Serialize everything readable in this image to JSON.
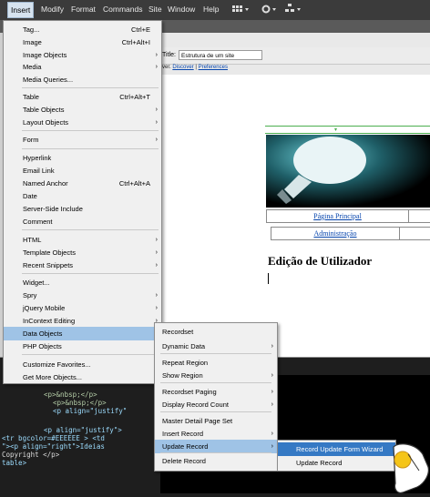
{
  "menubar": {
    "items": [
      "Insert",
      "Modify",
      "Format",
      "Commands",
      "Site",
      "Window",
      "Help"
    ]
  },
  "document": {
    "title_label": "Title:",
    "title_value": "Estrutura de um site",
    "infobar_prefix": "rver.",
    "infobar_link1": "Discover",
    "infobar_sep": "|",
    "infobar_link2": "Preferences",
    "nav_link1": "Página Principal",
    "nav_link2": "Administração",
    "heading": "Edição de Utilizador"
  },
  "code": {
    "lines": [
      "2>",
      "<p>&nbsp;</p>",
      "<p>&nbsp;</p>",
      "<p align=\"justify\"",
      "<p align=\"justify\">",
      "<tr bgcolor=#EEEEEE > <td",
      "\"><p align=\"right\">Ideias",
      "Copyright </p>",
      "table>"
    ]
  },
  "insert_menu": {
    "items": [
      {
        "label": "Tag...",
        "shortcut": "Ctrl+E",
        "sub": false
      },
      {
        "label": "Image",
        "shortcut": "Ctrl+Alt+I",
        "sub": false
      },
      {
        "label": "Image Objects",
        "shortcut": "",
        "sub": true
      },
      {
        "label": "Media",
        "shortcut": "",
        "sub": true
      },
      {
        "label": "Media Queries...",
        "shortcut": "",
        "sub": false
      },
      {
        "label": "Table",
        "shortcut": "Ctrl+Alt+T",
        "sub": false
      },
      {
        "label": "Table Objects",
        "shortcut": "",
        "sub": true
      },
      {
        "label": "Layout Objects",
        "shortcut": "",
        "sub": true
      },
      {
        "label": "Form",
        "shortcut": "",
        "sub": true
      },
      {
        "label": "Hyperlink",
        "shortcut": "",
        "sub": false
      },
      {
        "label": "Email Link",
        "shortcut": "",
        "sub": false
      },
      {
        "label": "Named Anchor",
        "shortcut": "Ctrl+Alt+A",
        "sub": false
      },
      {
        "label": "Date",
        "shortcut": "",
        "sub": false
      },
      {
        "label": "Server-Side Include",
        "shortcut": "",
        "sub": false
      },
      {
        "label": "Comment",
        "shortcut": "",
        "sub": false
      },
      {
        "label": "HTML",
        "shortcut": "",
        "sub": true
      },
      {
        "label": "Template Objects",
        "shortcut": "",
        "sub": true
      },
      {
        "label": "Recent Snippets",
        "shortcut": "",
        "sub": true
      },
      {
        "label": "Widget...",
        "shortcut": "",
        "sub": false
      },
      {
        "label": "Spry",
        "shortcut": "",
        "sub": true
      },
      {
        "label": "jQuery Mobile",
        "shortcut": "",
        "sub": true
      },
      {
        "label": "InContext Editing",
        "shortcut": "",
        "sub": true
      },
      {
        "label": "Data Objects",
        "shortcut": "",
        "sub": true
      },
      {
        "label": "PHP Objects",
        "shortcut": "",
        "sub": true
      },
      {
        "label": "Customize Favorites...",
        "shortcut": "",
        "sub": false
      },
      {
        "label": "Get More Objects...",
        "shortcut": "",
        "sub": false
      }
    ]
  },
  "data_objects_menu": {
    "items": [
      {
        "label": "Recordset",
        "sub": false
      },
      {
        "label": "Dynamic Data",
        "sub": true
      },
      {
        "label": "Repeat Region",
        "sub": false
      },
      {
        "label": "Show Region",
        "sub": true
      },
      {
        "label": "Recordset Paging",
        "sub": true
      },
      {
        "label": "Display Record Count",
        "sub": true
      },
      {
        "label": "Master Detail Page Set",
        "sub": false
      },
      {
        "label": "Insert Record",
        "sub": true
      },
      {
        "label": "Update Record",
        "sub": true
      },
      {
        "label": "Delete Record",
        "sub": false
      }
    ]
  },
  "update_record_menu": {
    "items": [
      {
        "label": "Record Update Form Wizard"
      },
      {
        "label": "Update Record"
      }
    ]
  },
  "colors": {
    "menubar": "#3b3b3b",
    "menu_bg": "#f0f0f0",
    "highlight": "#9fc3e6",
    "highlight_strong": "#3579c4",
    "link": "#0645ad"
  }
}
